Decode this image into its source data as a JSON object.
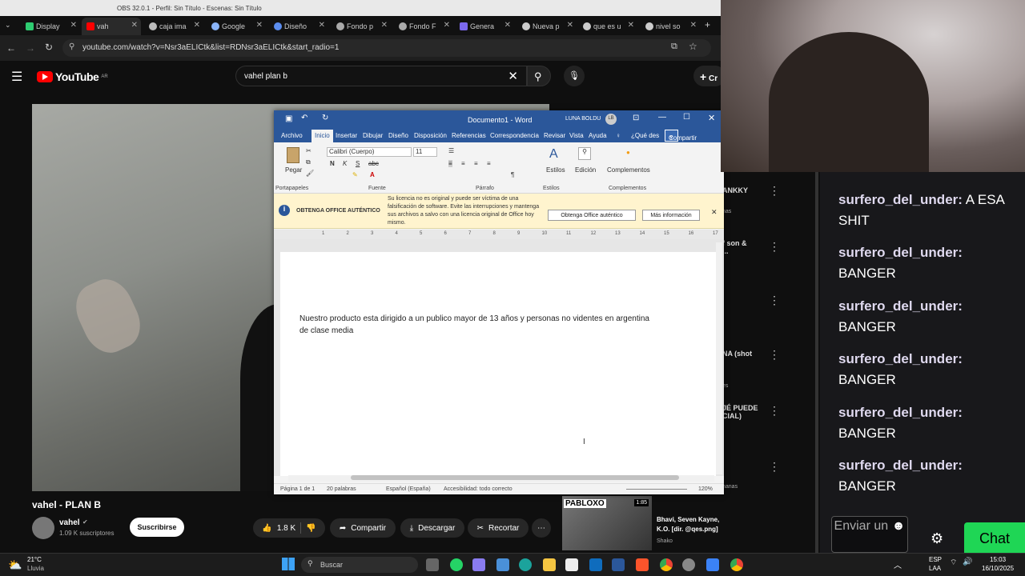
{
  "obs_bar": {
    "title": "OBS 32.0.1 - Perfil: Sin Título - Escenas: Sin Título"
  },
  "browser": {
    "tabs": [
      {
        "label": "Display"
      },
      {
        "label": "vah"
      },
      {
        "label": "caja ima"
      },
      {
        "label": "Google"
      },
      {
        "label": "Diseño"
      },
      {
        "label": "Fondo p"
      },
      {
        "label": "Fondo F"
      },
      {
        "label": "Genera"
      },
      {
        "label": "Nueva p"
      },
      {
        "label": "que es u"
      },
      {
        "label": "nivel so"
      }
    ],
    "url": "youtube.com/watch?v=Nsr3aELICtk&list=RDNsr3aELICtk&start_radio=1"
  },
  "youtube": {
    "logo": "YouTube",
    "region": "AR",
    "search_value": "vahel plan b",
    "create_label": "Cr",
    "video_title": "vahel - PLAN B",
    "channel": "vahel",
    "subscribers": "1.09 K suscriptores",
    "subscribe": "Suscribirse",
    "likes": "1.8 K",
    "share": "Compartir",
    "download": "Descargar",
    "clip": "Recortar",
    "side_items": [
      {
        "text": "ANKKY"
      },
      {
        "text": "nas"
      },
      {
        "text": "f son & ..."
      },
      {
        "text": "NA (shot"
      },
      {
        "text": "es"
      },
      {
        "text": "JÉ PUEDE CIAL)"
      },
      {
        "text": "nanas"
      }
    ],
    "rec_thumb_label": "PABLOXO",
    "rec_duration": "1:85",
    "rec_title": "Bhavi, Seven Kayne, Shako - K.O. [dir. @qes.png]",
    "rec_channel": "Shako"
  },
  "word": {
    "doc_title": "Documento1 - Word",
    "user": "LUNA BOLDU",
    "user_initials": "LB",
    "tabs": [
      "Archivo",
      "Inicio",
      "Insertar",
      "Dibujar",
      "Diseño",
      "Disposición",
      "Referencias",
      "Correspondencia",
      "Revisar",
      "Vista",
      "Ayuda"
    ],
    "tell_me": "¿Qué des",
    "share": "Compartir",
    "font": "Calibri (Cuerpo)",
    "size": "11",
    "groups": {
      "clipboard": "Portapapeles",
      "font": "Fuente",
      "paragraph": "Párrafo",
      "styles": "Estilos",
      "addins": "Complementos"
    },
    "paste": "Pegar",
    "styles_btn": "Estilos",
    "edit_btn": "Edición",
    "addins_btn": "Complementos",
    "warning": {
      "title": "OBTENGA OFFICE AUTÉNTICO",
      "body": "Su licencia no es original y puede ser víctima de una falsificación de software. Evite las interrupciones y mantenga sus archivos a salvo con una licencia original de Office hoy mismo.",
      "btn1": "Obtenga Office auténtico",
      "btn2": "Más información"
    },
    "ruler_ticks": [
      "1",
      "2",
      "3",
      "4",
      "5",
      "6",
      "7",
      "8",
      "9",
      "10",
      "11",
      "12",
      "13",
      "14",
      "15",
      "16",
      "17"
    ],
    "doc_text": "Nuestro producto esta dirigido a un publico mayor de 13 años y personas no videntes en argentina de clase media",
    "status": {
      "page": "Página 1 de 1",
      "words": "20 palabras",
      "lang": "Español (España)",
      "access": "Accesibilidad: todo correcto",
      "zoom": "120%"
    }
  },
  "chat": {
    "messages": [
      {
        "user": "surfero_del_under:",
        "text": "A ESA SHIT"
      },
      {
        "user": "surfero_del_under:",
        "text": "BANGER"
      },
      {
        "user": "surfero_del_under:",
        "text": "BANGER"
      },
      {
        "user": "surfero_del_under:",
        "text": "BANGER"
      },
      {
        "user": "surfero_del_under:",
        "text": "BANGER"
      },
      {
        "user": "surfero_del_under:",
        "text": "BANGER"
      }
    ],
    "send_label": "Enviar un",
    "chat_button": "Chat"
  },
  "taskbar": {
    "temp": "21°C",
    "weather": "Lluvia",
    "search": "Buscar",
    "lang": "ESP",
    "kbd": "LAA",
    "time": "15:03",
    "date": "16/10/2025"
  }
}
